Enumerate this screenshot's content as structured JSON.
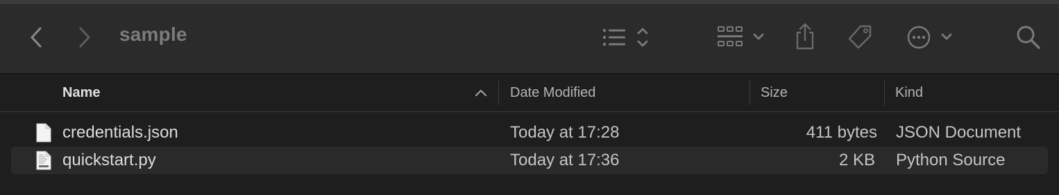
{
  "window": {
    "title": "sample"
  },
  "toolbar": {
    "buttons": [
      {
        "name": "back",
        "icon": "chevron-left-icon"
      },
      {
        "name": "forward",
        "icon": "chevron-right-icon"
      },
      {
        "name": "view-options",
        "icon": "list-view-icon"
      },
      {
        "name": "group",
        "icon": "grid-group-icon"
      },
      {
        "name": "share",
        "icon": "share-icon"
      },
      {
        "name": "tag",
        "icon": "tag-icon"
      },
      {
        "name": "action",
        "icon": "ellipsis-circle-icon"
      },
      {
        "name": "search",
        "icon": "search-icon"
      }
    ]
  },
  "columns": {
    "name": "Name",
    "date": "Date Modified",
    "size": "Size",
    "kind": "Kind",
    "sort_indicator": "ascending"
  },
  "files": [
    {
      "name": "credentials.json",
      "date": "Today at 17:28",
      "size": "411 bytes",
      "kind": "JSON Document",
      "icon": "json-file-icon"
    },
    {
      "name": "quickstart.py",
      "date": "Today at 17:36",
      "size": "2 KB",
      "kind": "Python Source",
      "icon": "python-file-icon"
    }
  ],
  "colors": {
    "background": "#1e1e1e",
    "toolbar": "#2b2b2b",
    "row_alt": "#2a2a2a",
    "text": "#dcdcdc",
    "icon_gray": "#7a7a7a"
  }
}
